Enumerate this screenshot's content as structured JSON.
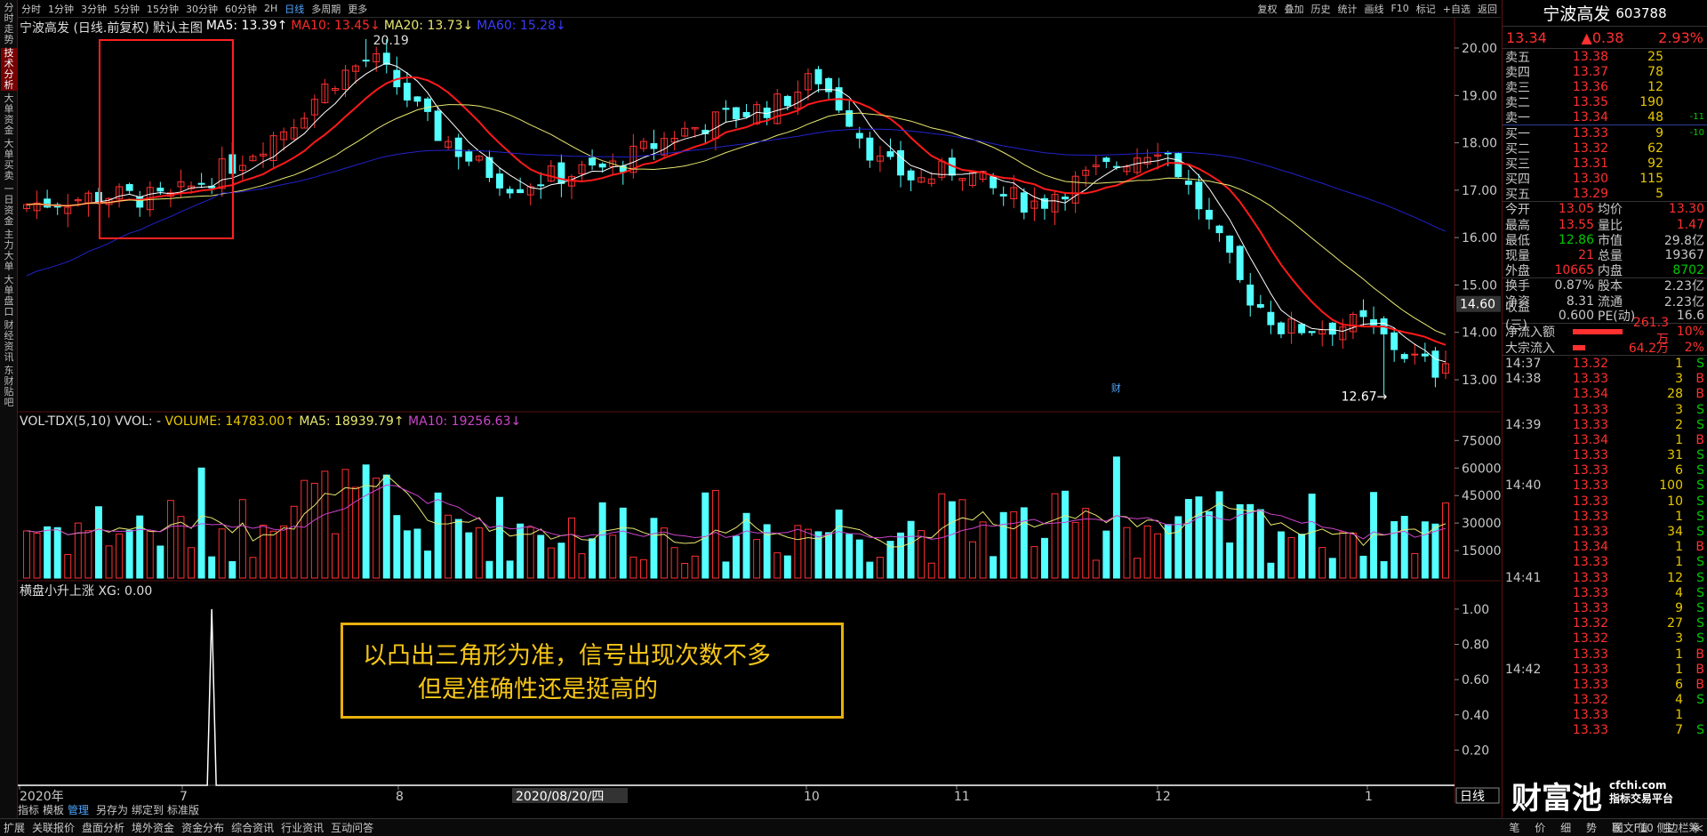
{
  "sidebar": [
    "分时走势",
    "技术分析",
    "大单资金",
    "大单买卖",
    "一日资金",
    "主力大单",
    "大单盘口",
    "财经资讯",
    "东财贴吧"
  ],
  "periods": [
    "分时",
    "1分钟",
    "3分钟",
    "5分钟",
    "15分钟",
    "30分钟",
    "60分钟",
    "2H",
    "日线",
    "多周期",
    "更多"
  ],
  "selected_period": "日线",
  "toolbar_right": [
    "复权",
    "叠加",
    "历史",
    "统计",
    "画线",
    "F10",
    "标记",
    "+自选",
    "返回"
  ],
  "main_legend": {
    "name": "宁波高发 (日线.前复权)",
    "indicator": "默认主图",
    "ma5": "MA5: 13.39↑",
    "ma10": "MA10: 13.45↓",
    "ma20": "MA20: 13.73↓",
    "ma60": "MA60: 15.28↓"
  },
  "vol_legend": {
    "name": "VOL-TDX(5,10) VVOL: -",
    "volume": "VOLUME: 14783.00↑",
    "ma5": "MA5: 18939.79↑",
    "ma10": "MA10: 19256.63↓"
  },
  "ind_legend": "横盘小升上涨 XG: 0.00",
  "annotation": {
    "line1": "以凸出三角形为准，信号出现次数不多",
    "line2": "但是准确性还是挺高的"
  },
  "labels": {
    "high": "20.19",
    "low": "12.67→",
    "cai": "财",
    "cur_tag": "14.60",
    "date_tag": "2020/08/20/四",
    "period_tag": "日线"
  },
  "x_axis": [
    "2020年",
    "7",
    "8",
    "10",
    "11",
    "12",
    "1"
  ],
  "y_price": [
    "20.00",
    "19.00",
    "18.00",
    "17.00",
    "16.00",
    "15.00",
    "14.00",
    "13.00"
  ],
  "y_vol": [
    "75000",
    "60000",
    "45000",
    "30000",
    "15000"
  ],
  "y_ind": [
    "1.00",
    "0.80",
    "0.60",
    "0.40",
    "0.20"
  ],
  "bottom_bar": [
    "扩展",
    "关联报价",
    "盘面分析",
    "境外资金",
    "资金分布",
    "综合资讯",
    "行业资讯",
    "互动问答"
  ],
  "bottom_bar2": [
    "指标",
    "模板",
    "管理",
    "另存为",
    "绑定到",
    "标准版"
  ],
  "bottom_right": "图文F10 侧边栏 ≪",
  "right_panel": {
    "name": "宁波高发",
    "code": "603788",
    "price": "13.34",
    "change": "▲0.38",
    "pct": "2.93%",
    "asks": [
      {
        "l": "卖五",
        "p": "13.38",
        "v": "25",
        "d": ""
      },
      {
        "l": "卖四",
        "p": "13.37",
        "v": "78",
        "d": ""
      },
      {
        "l": "卖三",
        "p": "13.36",
        "v": "12",
        "d": ""
      },
      {
        "l": "卖二",
        "p": "13.35",
        "v": "190",
        "d": ""
      },
      {
        "l": "卖一",
        "p": "13.34",
        "v": "48",
        "d": "-11"
      }
    ],
    "bids": [
      {
        "l": "买一",
        "p": "13.33",
        "v": "9",
        "d": "-10"
      },
      {
        "l": "买二",
        "p": "13.32",
        "v": "62",
        "d": ""
      },
      {
        "l": "买三",
        "p": "13.31",
        "v": "92",
        "d": ""
      },
      {
        "l": "买四",
        "p": "13.30",
        "v": "115",
        "d": ""
      },
      {
        "l": "买五",
        "p": "13.29",
        "v": "5",
        "d": ""
      }
    ],
    "info1": [
      [
        "今开",
        "13.05",
        "均价",
        "13.30"
      ],
      [
        "最高",
        "13.55",
        "量比",
        "1.47"
      ],
      [
        "最低",
        "12.86",
        "市值",
        "29.8亿"
      ],
      [
        "现量",
        "21",
        "总量",
        "19367"
      ],
      [
        "外盘",
        "10665",
        "内盘",
        "8702"
      ]
    ],
    "info2": [
      [
        "换手",
        "0.87%",
        "股本",
        "2.23亿"
      ],
      [
        "净资",
        "8.31",
        "流通",
        "2.23亿"
      ],
      [
        "收益(三)",
        "0.600",
        "PE(动)",
        "16.6"
      ]
    ],
    "flow": [
      {
        "k": "净流入额",
        "v": "261.3万",
        "p": "10%",
        "w": 56
      },
      {
        "k": "大宗流入",
        "v": "64.2万",
        "p": "2%",
        "w": 14
      }
    ],
    "ticks": [
      [
        "14:37",
        "13.32",
        "1",
        "S"
      ],
      [
        "14:38",
        "13.33",
        "3",
        "B"
      ],
      [
        "",
        "13.34",
        "28",
        "B"
      ],
      [
        "",
        "13.33",
        "3",
        "S"
      ],
      [
        "14:39",
        "13.33",
        "2",
        "S"
      ],
      [
        "",
        "13.34",
        "1",
        "B"
      ],
      [
        "",
        "13.33",
        "31",
        "S"
      ],
      [
        "",
        "13.33",
        "6",
        "S"
      ],
      [
        "14:40",
        "13.33",
        "100",
        "S"
      ],
      [
        "",
        "13.33",
        "10",
        "S"
      ],
      [
        "",
        "13.33",
        "1",
        "S"
      ],
      [
        "",
        "13.33",
        "34",
        "S"
      ],
      [
        "",
        "13.34",
        "1",
        "B"
      ],
      [
        "",
        "13.33",
        "1",
        "S"
      ],
      [
        "14:41",
        "13.33",
        "12",
        "S"
      ],
      [
        "",
        "13.33",
        "4",
        "S"
      ],
      [
        "",
        "13.33",
        "9",
        "S"
      ],
      [
        "",
        "13.32",
        "27",
        "S"
      ],
      [
        "",
        "13.32",
        "3",
        "S"
      ],
      [
        "",
        "13.33",
        "1",
        "B"
      ],
      [
        "14:42",
        "13.33",
        "1",
        "B"
      ],
      [
        "",
        "13.33",
        "6",
        "B"
      ],
      [
        "",
        "13.32",
        "4",
        "S"
      ],
      [
        "",
        "13.33",
        "1",
        ""
      ],
      [
        "",
        "13.33",
        "7",
        "S"
      ]
    ],
    "tabs": [
      "笔",
      "价",
      "细",
      "势",
      "联",
      "值",
      "主",
      "筹"
    ]
  },
  "watermark": {
    "text": "财富池",
    "site": "cfchi.com",
    "sub": "指标交易平台"
  },
  "colors": {
    "up": "#ff3030",
    "down": "#54ffff",
    "ma5": "#ffffff",
    "ma10": "#ff1a1a",
    "ma20": "#e8e870",
    "ma60": "#2222cc",
    "volma10": "#cc44cc",
    "accent": "#e8b10c"
  }
}
